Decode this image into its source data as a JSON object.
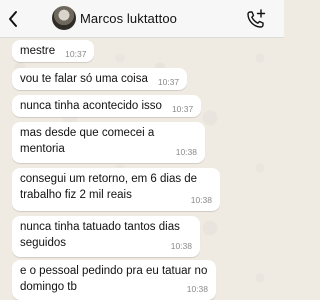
{
  "header": {
    "contact_name": "Marcos luktattoo"
  },
  "icons": {
    "back": "chevron-left-icon",
    "avatar": "avatar-photo",
    "call": "phone-add-icon"
  },
  "colors": {
    "chat_background": "#efeae2",
    "bubble_incoming": "#ffffff",
    "header_background": "#f7f7f7",
    "timestamp": "#8a8a8a"
  },
  "messages": [
    {
      "text": "mestre",
      "time": "10:37"
    },
    {
      "text": "vou te falar só uma coisa",
      "time": "10:37"
    },
    {
      "text": "nunca tinha acontecido isso",
      "time": "10:37"
    },
    {
      "text": "mas desde que comecei a mentoria",
      "time": "10:38"
    },
    {
      "text": "consegui um retorno, em 6 dias de trabalho fiz 2 mil reais",
      "time": "10:38"
    },
    {
      "text": "nunca tinha tatuado tantos dias seguidos",
      "time": "10:38"
    },
    {
      "text": "e o pessoal pedindo pra eu tatuar no domingo tb",
      "time": "10:38"
    }
  ]
}
